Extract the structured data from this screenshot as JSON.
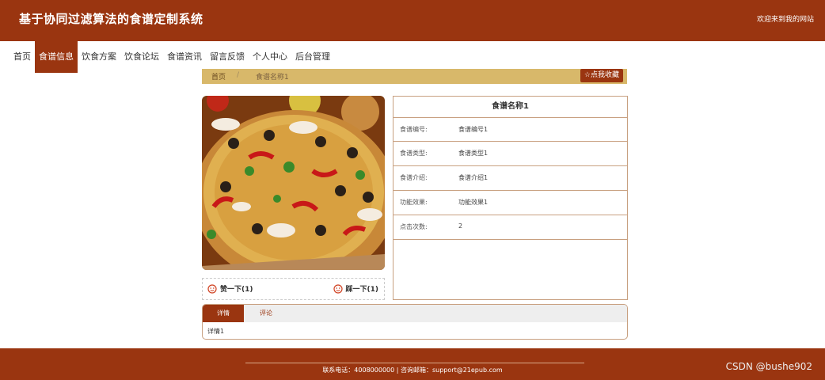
{
  "header": {
    "title": "基于协同过滤算法的食谱定制系统",
    "welcome": "欢迎来到我的网站"
  },
  "nav": {
    "items": [
      {
        "label": "首页"
      },
      {
        "label": "食谱信息"
      },
      {
        "label": "饮食方案"
      },
      {
        "label": "饮食论坛"
      },
      {
        "label": "食谱资讯"
      },
      {
        "label": "留言反馈"
      },
      {
        "label": "个人中心"
      },
      {
        "label": "后台管理"
      }
    ],
    "active_index": 1
  },
  "breadcrumb": {
    "home": "首页",
    "separator": "/",
    "current": "食谱名称1",
    "favorite_button": "☆点我收藏"
  },
  "votes": {
    "up_label": "赞一下(1)",
    "down_label": "踩一下(1)"
  },
  "info": {
    "title": "食谱名称1",
    "rows": [
      {
        "label": "食谱编号:",
        "value": "食谱编号1"
      },
      {
        "label": "食谱类型:",
        "value": "食谱类型1"
      },
      {
        "label": "食谱介绍:",
        "value": "食谱介绍1"
      },
      {
        "label": "功能效果:",
        "value": "功能效果1"
      },
      {
        "label": "点击次数:",
        "value": "2"
      }
    ]
  },
  "tabs": {
    "items": [
      {
        "label": "详情"
      },
      {
        "label": "评论"
      }
    ],
    "content": "详情1"
  },
  "footer": {
    "text": "联系电话：4008000000 | 咨询邮箱：support@21epub.com"
  },
  "watermark": "CSDN @bushe902",
  "colors": {
    "primary": "#9a3510",
    "breadcrumb_bg": "#d8b86a",
    "border": "#c8a080"
  },
  "icons": {
    "favorite": "star-icon",
    "vote": "smiley-icon"
  }
}
